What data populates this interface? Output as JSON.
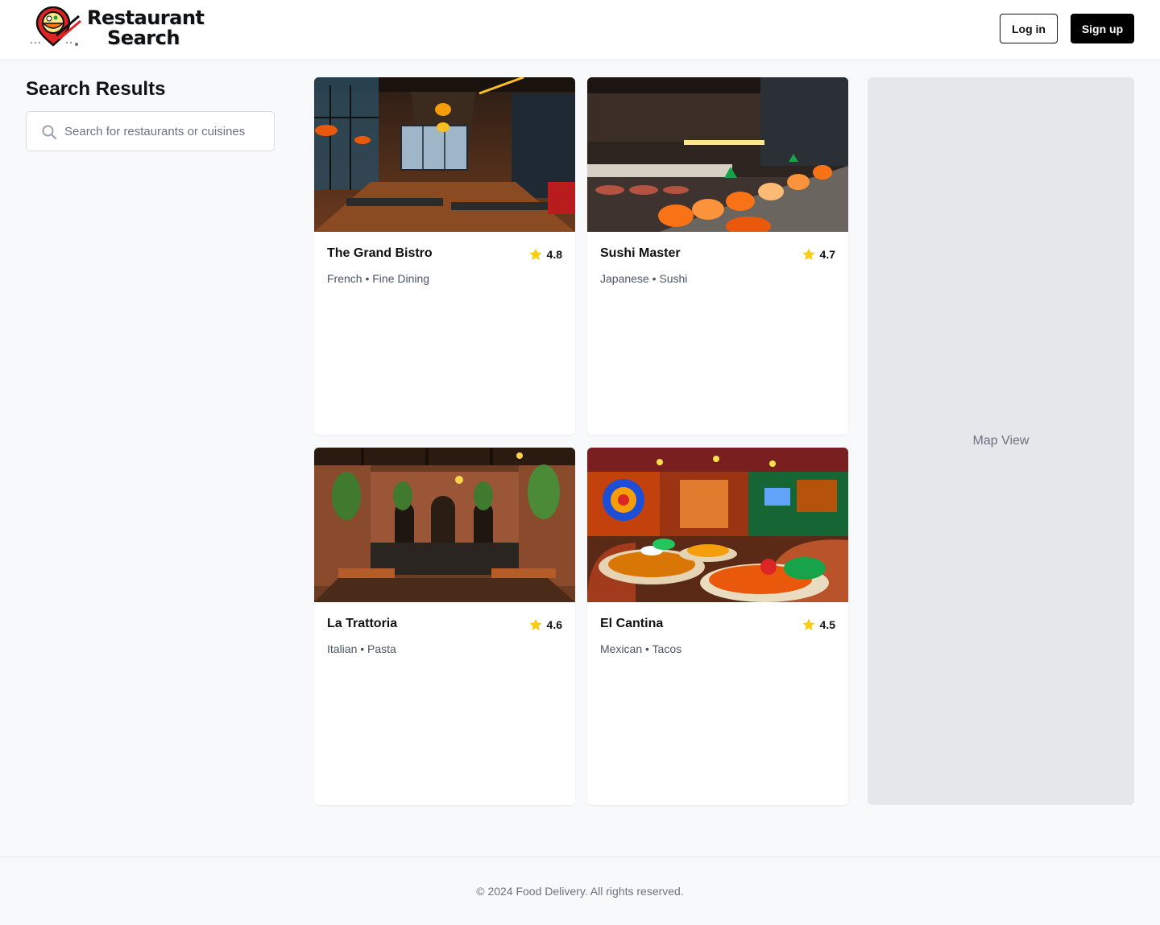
{
  "header": {
    "logo_line1": "Restaurant",
    "logo_line2": "Search",
    "login_label": "Log in",
    "signup_label": "Sign up"
  },
  "sidebar": {
    "title": "Search Results",
    "search_placeholder": "Search for restaurants or cuisines",
    "search_value": ""
  },
  "restaurants": [
    {
      "name": "The Grand Bistro",
      "rating": "4.8",
      "tags": "French • Fine Dining",
      "image": "bistro-interior"
    },
    {
      "name": "Sushi Master",
      "rating": "4.7",
      "tags": "Japanese • Sushi",
      "image": "sushi-bar"
    },
    {
      "name": "La Trattoria",
      "rating": "4.6",
      "tags": "Italian • Pasta",
      "image": "trattoria-interior"
    },
    {
      "name": "El Cantina",
      "rating": "4.5",
      "tags": "Mexican • Tacos",
      "image": "cantina-food"
    }
  ],
  "map": {
    "label": "Map View"
  },
  "footer": {
    "text": "© 2024 Food Delivery. All rights reserved."
  },
  "colors": {
    "star": "#facc15",
    "primary": "#000000",
    "map_bg": "#e5e7eb",
    "page_bg": "#f8f9fb"
  },
  "icons": {
    "search": "search-icon",
    "rating": "star-icon",
    "logo": "restaurant-pin-logo"
  }
}
